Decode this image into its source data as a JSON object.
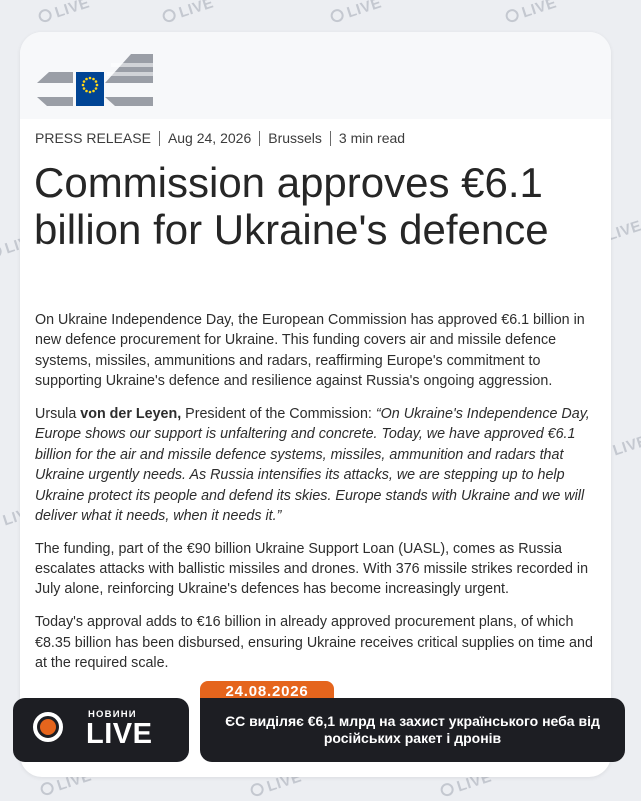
{
  "watermark": {
    "text": "LIVE"
  },
  "press_release": {
    "category": "PRESS RELEASE",
    "date": "Aug 24, 2026",
    "location": "Brussels",
    "read_time": "3 min read",
    "title": "Commission approves €6.1 billion for Ukraine's defence",
    "paragraphs": {
      "p1": "On Ukraine Independence Day, the European Commission has approved €6.1 billion in new defence procurement for Ukraine. This funding covers air and missile defence systems, missiles, ammunitions and radars, reaffirming Europe's commitment to supporting Ukraine's defence and resilience against Russia's ongoing aggression.",
      "p2_name_plain": "Ursula ",
      "p2_name_bold": "von der Leyen,",
      "p2_role": " President of the Commission: ",
      "p2_quote": "“On Ukraine's Independence Day, Europe shows our support is unfaltering and concrete. Today, we have approved €6.1 billion for the air and missile defence systems, missiles, ammunition and radars that Ukraine urgently needs. As Russia intensifies its attacks, we are stepping up to help Ukraine protect its people and defend its skies. Europe stands with Ukraine and we will deliver what it needs, when it needs it.”",
      "p3": "The funding, part of the €90 billion Ukraine Support Loan (UASL), comes as Russia escalates attacks with ballistic missiles and drones. With 376 missile strikes recorded in July alone, reinforcing Ukraine's defences has become increasingly urgent.",
      "p4": "Today's approval adds to €16 billion in already approved procurement plans, of which €8.35 billion has been disbursed, ensuring Ukraine receives critical supplies on time and at the required scale."
    }
  },
  "news_overlay": {
    "logo_small": "НОВИНИ",
    "logo_big": "LIVE",
    "date": "24.08.2026",
    "headline": "ЄС виділяє €6,1 млрд на захист українського неба від російських ракет і дронів"
  },
  "colors": {
    "accent": "#e5651d",
    "eu_blue": "#004494",
    "eu_yellow": "#ffd617",
    "overlay_bg": "#1d1e23"
  }
}
